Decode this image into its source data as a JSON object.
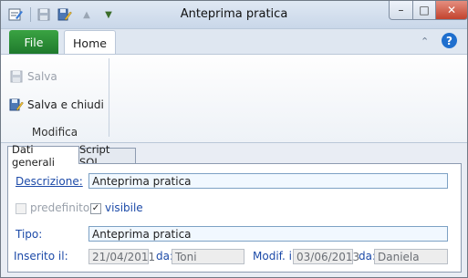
{
  "window": {
    "title": "Anteprima pratica",
    "minimize_glyph": "–",
    "maximize_glyph": "□",
    "close_glyph": "✕"
  },
  "quick_access": [
    {
      "name": "app-menu-icon",
      "glyph": "✎"
    },
    {
      "name": "save-icon",
      "glyph": "▣"
    },
    {
      "name": "save-edit-icon",
      "glyph": "✎"
    },
    {
      "name": "up-arrow-icon",
      "glyph": "▲"
    },
    {
      "name": "down-arrow-icon",
      "glyph": "▼"
    }
  ],
  "ribbon": {
    "tabs": {
      "file": "File",
      "home": "Home"
    },
    "collapse_glyph": "⌃",
    "help_glyph": "?",
    "buttons": [
      {
        "label": "Salva",
        "enabled": false
      },
      {
        "label": "Salva e chiudi",
        "enabled": true
      }
    ],
    "group_label": "Modifica"
  },
  "doc_tabs": [
    {
      "label": "Dati generali",
      "active": true
    },
    {
      "label": "Script SQL",
      "active": false
    }
  ],
  "form": {
    "descrizione_label": "Descrizione:",
    "descrizione_value": "Anteprima pratica",
    "predefinito_label": "predefinito",
    "predefinito_checked": false,
    "visibile_label": "visibile",
    "visibile_checked": true,
    "tipo_label": "Tipo:",
    "tipo_value": "Anteprima pratica",
    "inserito_label": "Inserito il:",
    "inserito_value": "21/04/2011",
    "da1_label": "da:",
    "da1_value": "Toni",
    "modif_label": "Modif. il:",
    "modif_value": "03/06/2013",
    "da2_label": "da:",
    "da2_value": "Daniela"
  },
  "colors": {
    "file_tab": "#2a8f38",
    "help": "#1f6fce",
    "label_blue": "#1c4aa8",
    "close_button": "#c2432e"
  }
}
